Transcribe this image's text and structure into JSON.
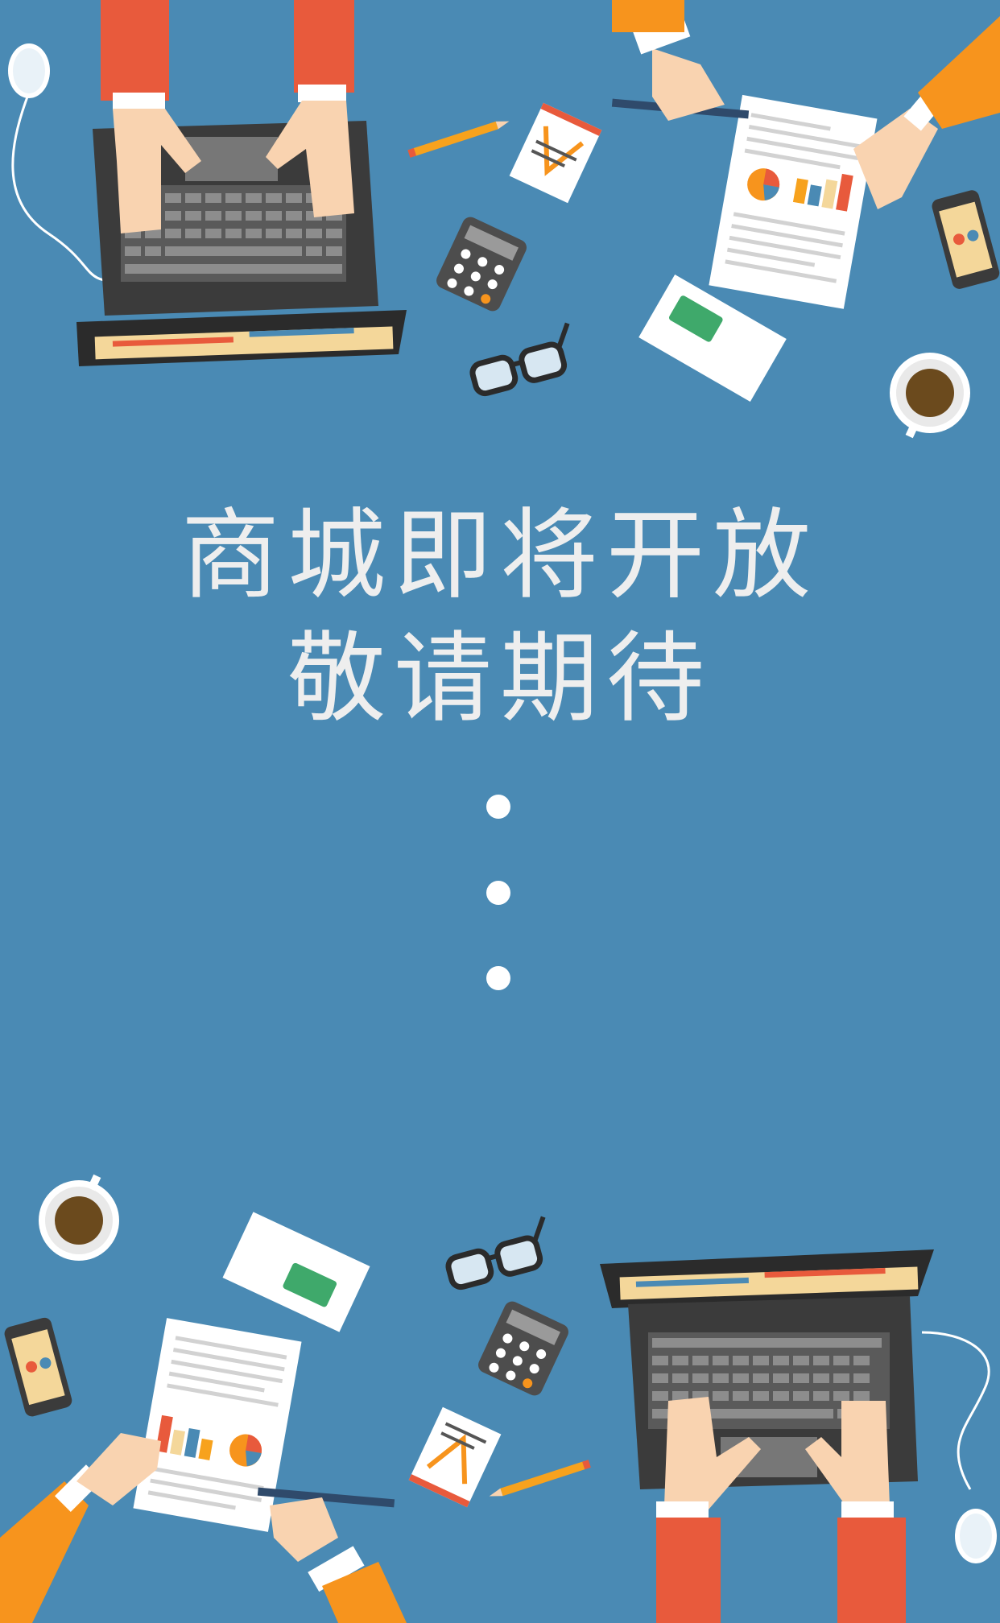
{
  "headline": {
    "line1": "商城即将开放",
    "line2": "敬请期待"
  },
  "loading_dots": 3,
  "colors": {
    "background": "#4a8ab4",
    "text": "#eeeeee",
    "accent_orange": "#f7941d",
    "accent_red": "#e85a3c"
  },
  "illustration": {
    "top_icons": [
      "laptop-icon",
      "mouse-icon",
      "pencil-icon",
      "notepad-icon",
      "calculator-icon",
      "glasses-icon",
      "document-icon",
      "envelope-icon",
      "smartphone-icon",
      "coffee-cup-icon"
    ],
    "bottom_icons": [
      "laptop-icon",
      "mouse-icon",
      "pencil-icon",
      "notepad-icon",
      "calculator-icon",
      "glasses-icon",
      "document-icon",
      "envelope-icon",
      "smartphone-icon",
      "coffee-cup-icon"
    ]
  }
}
